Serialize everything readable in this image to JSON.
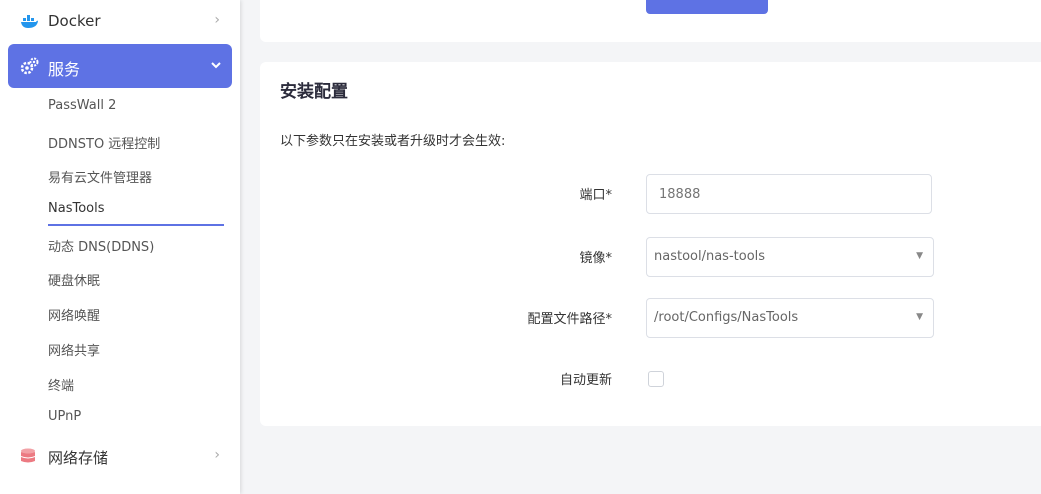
{
  "sidebar": {
    "top_item": {
      "label": "Docker",
      "icon": "docker-icon"
    },
    "active_item": {
      "label": "服务",
      "icon": "gears-icon"
    },
    "sub_items": [
      {
        "label": "PassWall 2"
      },
      {
        "label": "DDNSTO 远程控制"
      },
      {
        "label": "易有云文件管理器"
      },
      {
        "label": "NasTools"
      },
      {
        "label": "动态 DNS(DDNS)"
      },
      {
        "label": "硬盘休眠"
      },
      {
        "label": "网络唤醒"
      },
      {
        "label": "网络共享"
      },
      {
        "label": "终端"
      },
      {
        "label": "UPnP"
      }
    ],
    "selected_sub_item": "NasTools",
    "bottom_item": {
      "label": "网络存储",
      "icon": "database-icon"
    }
  },
  "card": {
    "title": "安装配置",
    "description": "以下参数只在安装或者升级时才会生效:",
    "fields": {
      "port": {
        "label": "端口*",
        "placeholder": "18888"
      },
      "image": {
        "label": "镜像*",
        "value": "nastool/nas-tools"
      },
      "config_path": {
        "label": "配置文件路径*",
        "value": "/root/Configs/NasTools"
      },
      "auto_update": {
        "label": "自动更新",
        "checked": false
      }
    }
  },
  "colors": {
    "accent": "#5e72e4",
    "background": "#f4f5f7"
  }
}
